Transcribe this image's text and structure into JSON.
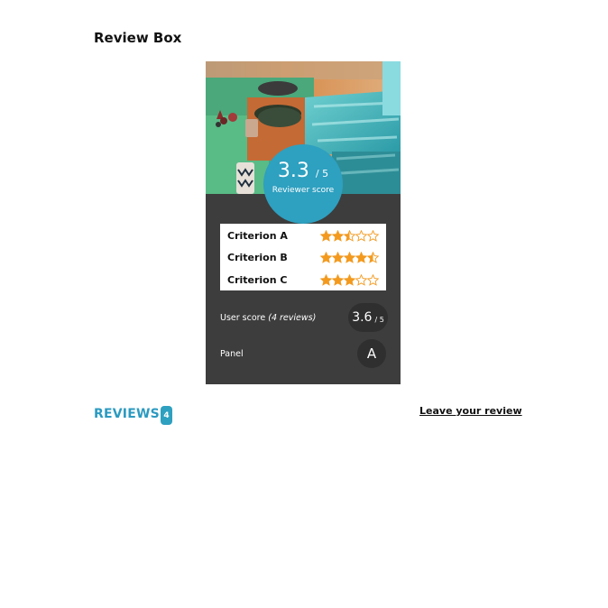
{
  "page": {
    "title": "Review Box"
  },
  "review_box": {
    "reviewer_score": {
      "value": "3.3",
      "out_of": "/ 5",
      "caption": "Reviewer score"
    },
    "criteria": [
      {
        "label": "Criterion A",
        "rating": 2.5,
        "max": 5
      },
      {
        "label": "Criterion B",
        "rating": 4.5,
        "max": 5
      },
      {
        "label": "Criterion C",
        "rating": 3,
        "max": 5
      }
    ],
    "user_score": {
      "label": "User score",
      "count_text": "(4 reviews)",
      "value": "3.6",
      "out_of": "/ 5"
    },
    "panel": {
      "label": "Panel",
      "value": "A"
    }
  },
  "reviews": {
    "heading": "REVIEWS",
    "count": "4",
    "leave_review_label": "Leave your review"
  },
  "colors": {
    "accent": "#2ea0c0",
    "star": "#f39a1e",
    "box_background": "#3d3d3d"
  }
}
